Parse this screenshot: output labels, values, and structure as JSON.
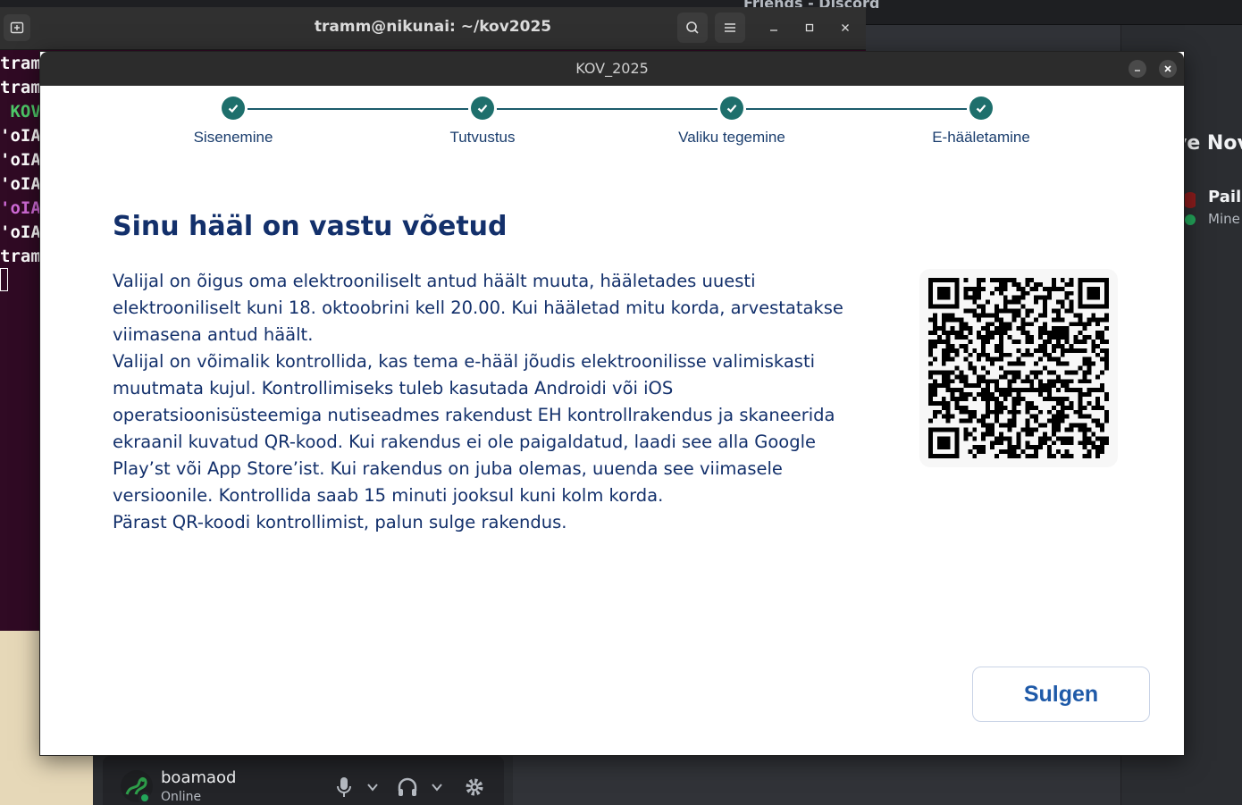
{
  "discord": {
    "window_title": "Friends - Discord",
    "active_now_title": "ve Nov",
    "friend": {
      "name": "Paila",
      "status": "Mine"
    },
    "user": {
      "name": "boamaod",
      "status": "Online"
    }
  },
  "terminal": {
    "title": "tramm@nikunai: ~/kov2025",
    "lines": [
      {
        "text": "tram",
        "color": "#ffffff"
      },
      {
        "text": "tram",
        "color": "#ffffff"
      },
      {
        "text": " KOV",
        "color": "#4ec968"
      },
      {
        "text": "'oIA",
        "color": "#ffffff"
      },
      {
        "text": "'oIA",
        "color": "#ffffff"
      },
      {
        "text": "'oIA",
        "color": "#ffffff"
      },
      {
        "text": "'oIA",
        "color": "#cf6ad6"
      },
      {
        "text": "'oIA",
        "color": "#ffffff"
      },
      {
        "text": "tram",
        "color": "#ffffff"
      }
    ]
  },
  "kov": {
    "window_title": "KOV_2025",
    "steps": [
      "Sisenemine",
      "Tutvustus",
      "Valiku tegemine",
      "E-hääletamine"
    ],
    "heading": "Sinu hääl on vastu võetud",
    "paragraph_lines": [
      "Valijal on õigus oma elektrooniliselt antud häält muuta, hääletades uuesti",
      "elektrooniliselt kuni 18. oktoobrini kell 20.00. Kui hääletad mitu korda, arvestatakse",
      "viimasena antud häält.",
      "Valijal on võimalik kontrollida, kas tema e-hääl jõudis elektroonilisse valimiskasti",
      "muutmata kujul. Kontrollimiseks tuleb kasutada Androidi või iOS",
      "operatsioonisüsteemiga nutiseadmes rakendust EH kontrollrakendus ja skaneerida",
      "ekraanil kuvatud QR-kood. Kui rakendus ei ole paigaldatud, laadi see alla Google",
      "Play’st või App Store’ist. Kui rakendus on juba olemas, uuenda see viimasele",
      "versioonile. Kontrollida saab 15 minuti jooksul kuni kolm korda.",
      "Pärast QR-koodi kontrollimist, palun sulge rakendus."
    ],
    "close_button": "Sulgen"
  }
}
